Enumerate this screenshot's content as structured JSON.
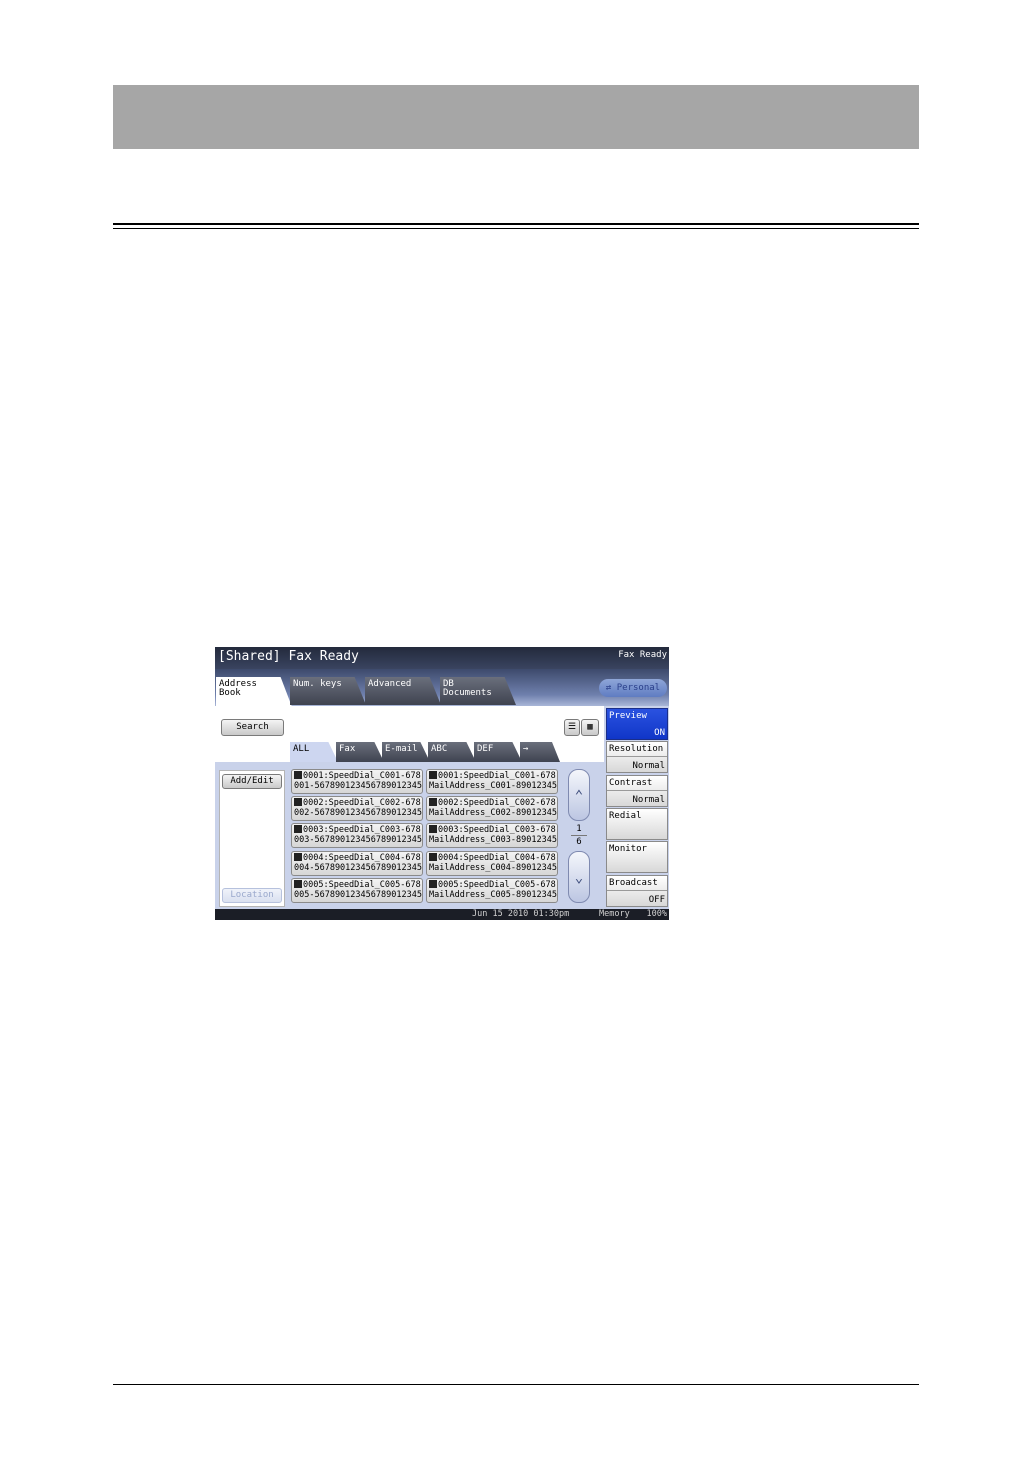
{
  "screen": {
    "title": "[Shared] Fax Ready",
    "status_right": "Fax Ready",
    "tabs": [
      {
        "line1": "Address",
        "line2": "Book"
      },
      {
        "line1": "Num. keys",
        "line2": ""
      },
      {
        "line1": "Advanced",
        "line2": ""
      },
      {
        "line1": "DB",
        "line2": "Documents"
      }
    ],
    "personal_label": "Personal",
    "search_label": "Search",
    "filter_tabs": [
      "ALL",
      "Fax",
      "E-mail",
      "ABC",
      "DEF",
      "→"
    ],
    "add_edit_label": "Add/Edit",
    "location_label": "Location",
    "entries_left": [
      {
        "line1": "0001:SpeedDial_C001-678",
        "line2": "001-5678901234567890123​45"
      },
      {
        "line1": "0002:SpeedDial_C002-678",
        "line2": "002-5678901234567890123​45"
      },
      {
        "line1": "0003:SpeedDial_C003-678",
        "line2": "003-5678901234567890123​45"
      },
      {
        "line1": "0004:SpeedDial_C004-678",
        "line2": "004-5678901234567890123​45"
      },
      {
        "line1": "0005:SpeedDial_C005-678",
        "line2": "005-5678901234567890123​45"
      }
    ],
    "entries_right": [
      {
        "line1": "0001:SpeedDial_C001-678",
        "line2": "MailAddress_C001-89012345"
      },
      {
        "line1": "0002:SpeedDial_C002-678",
        "line2": "MailAddress_C002-89012345"
      },
      {
        "line1": "0003:SpeedDial_C003-678",
        "line2": "MailAddress_C003-89012345"
      },
      {
        "line1": "0004:SpeedDial_C004-678",
        "line2": "MailAddress_C004-89012345"
      },
      {
        "line1": "0005:SpeedDial_C005-678",
        "line2": "MailAddress_C005-89012345"
      }
    ],
    "page_current": "1",
    "page_total": "6",
    "side_buttons": [
      {
        "label": "Preview",
        "value": "ON"
      },
      {
        "label": "Resolution",
        "value": "Normal"
      },
      {
        "label": "Contrast",
        "value": "Normal"
      },
      {
        "label": "Redial",
        "value": ""
      },
      {
        "label": "Monitor",
        "value": ""
      },
      {
        "label": "Broadcast",
        "value": "OFF"
      }
    ],
    "statusbar": {
      "datetime": "Jun 15 2010 01:30pm",
      "memory_label": "Memory",
      "memory_value": "100%"
    }
  }
}
